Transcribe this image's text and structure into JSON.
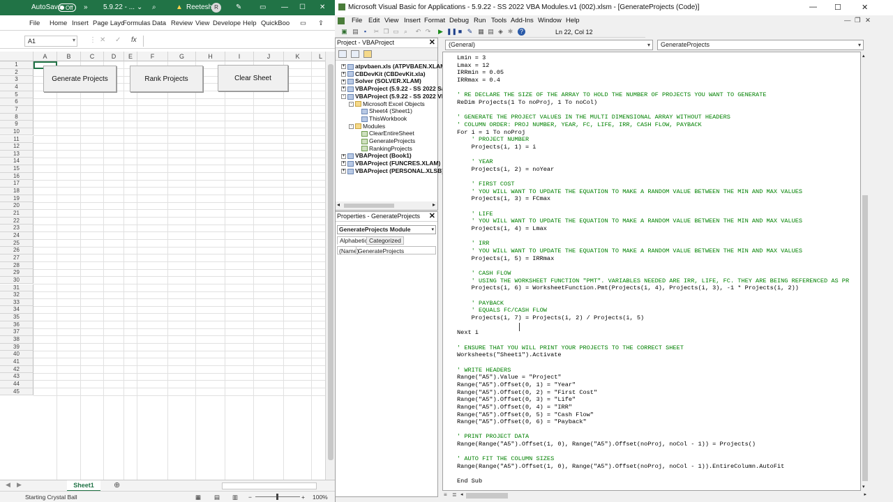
{
  "excel": {
    "autosave_label": "AutoSave",
    "autosave_state": "Off",
    "filename_short": "5.9.22 - ...",
    "user_name": "Reetesh",
    "user_initial": "R",
    "menu": [
      "File",
      "Home",
      "Insert",
      "Page Layo",
      "Formulas",
      "Data",
      "Review",
      "View",
      "Develope",
      "Help",
      "QuickBoo"
    ],
    "name_box": "A1",
    "fx": "fx",
    "columns": [
      "A",
      "B",
      "C",
      "D",
      "E",
      "F",
      "G",
      "H",
      "I",
      "J",
      "K",
      "L"
    ],
    "rows": [
      "1",
      "2",
      "3",
      "4",
      "5",
      "6",
      "7",
      "8",
      "9",
      "10",
      "11",
      "12",
      "13",
      "14",
      "15",
      "16",
      "17",
      "18",
      "19",
      "20",
      "21",
      "22",
      "23",
      "24",
      "25",
      "26",
      "27",
      "28",
      "29",
      "30",
      "31",
      "32",
      "33",
      "34",
      "35",
      "36",
      "37",
      "38",
      "39",
      "40",
      "41",
      "42",
      "43",
      "44",
      "45"
    ],
    "buttons": {
      "generate": "Generate Projects",
      "rank": "Rank Projects",
      "clear": "Clear Sheet"
    },
    "sheet_tab": "Sheet1",
    "status": "Starting Crystal Ball",
    "zoom": "100%"
  },
  "vba": {
    "title": "Microsoft Visual Basic for Applications - 5.9.22 - SS 2022 VBA Modules.v1 (002).xlsm - [GenerateProjects (Code)]",
    "menu": [
      "File",
      "Edit",
      "View",
      "Insert",
      "Format",
      "Debug",
      "Run",
      "Tools",
      "Add-Ins",
      "Window",
      "Help"
    ],
    "position": "Ln 22, Col 12",
    "project_title": "Project - VBAProject",
    "tree": [
      {
        "text": "atpvbaen.xls (ATPVBAEN.XLAM)",
        "level": 0,
        "bold": true,
        "toggle": "+",
        "icon": "proj"
      },
      {
        "text": "CBDevKit (CBDevKit.xla)",
        "level": 0,
        "bold": true,
        "toggle": "+",
        "icon": "proj"
      },
      {
        "text": "Solver (SOLVER.XLAM)",
        "level": 0,
        "bold": true,
        "toggle": "+",
        "icon": "proj"
      },
      {
        "text": "VBAProject (5.9.22 - SS 2022 Sa",
        "level": 0,
        "bold": true,
        "toggle": "+",
        "icon": "proj"
      },
      {
        "text": "VBAProject (5.9.22 - SS 2022 VI",
        "level": 0,
        "bold": true,
        "toggle": "-",
        "icon": "proj"
      },
      {
        "text": "Microsoft Excel Objects",
        "level": 1,
        "bold": false,
        "toggle": "-",
        "icon": "folder"
      },
      {
        "text": "Sheet4 (Sheet1)",
        "level": 2,
        "bold": false,
        "toggle": "",
        "icon": "sheet"
      },
      {
        "text": "ThisWorkbook",
        "level": 2,
        "bold": false,
        "toggle": "",
        "icon": "sheet"
      },
      {
        "text": "Modules",
        "level": 1,
        "bold": false,
        "toggle": "-",
        "icon": "folder"
      },
      {
        "text": "ClearEntireSheet",
        "level": 2,
        "bold": false,
        "toggle": "",
        "icon": "mod"
      },
      {
        "text": "GenerateProjects",
        "level": 2,
        "bold": false,
        "toggle": "",
        "icon": "mod"
      },
      {
        "text": "RankingProjects",
        "level": 2,
        "bold": false,
        "toggle": "",
        "icon": "mod"
      },
      {
        "text": "VBAProject (Book1)",
        "level": 0,
        "bold": true,
        "toggle": "+",
        "icon": "proj"
      },
      {
        "text": "VBAProject (FUNCRES.XLAM)",
        "level": 0,
        "bold": true,
        "toggle": "+",
        "icon": "proj"
      },
      {
        "text": "VBAProject (PERSONAL.XLSB)",
        "level": 0,
        "bold": true,
        "toggle": "+",
        "icon": "proj"
      }
    ],
    "properties_title": "Properties - GenerateProjects",
    "properties_object": "GenerateProjects Module",
    "properties_tabs": [
      "Alphabetic",
      "Categorized"
    ],
    "properties_name_key": "(Name)",
    "properties_name_value": "GenerateProjects",
    "combo_general": "(General)",
    "combo_proc": "GenerateProjects",
    "code_lines": [
      {
        "t": "Lmin = 3",
        "c": "#000"
      },
      {
        "t": "Lmax = 12",
        "c": "#000"
      },
      {
        "t": "IRRmin = 0.05",
        "c": "#000"
      },
      {
        "t": "IRRmax = 0.4",
        "c": "#000"
      },
      {
        "t": "",
        "c": "#000"
      },
      {
        "t": "' RE DECLARE THE SIZE OF THE ARRAY TO HOLD THE NUMBER OF PROJECTS YOU WANT TO GENERATE",
        "c": "#008000"
      },
      {
        "t": "ReDim Projects(1 To noProj, 1 To noCol)",
        "c": "#000"
      },
      {
        "t": "",
        "c": "#000"
      },
      {
        "t": "' GENERATE THE PROJECT VALUES IN THE MULTI DIMENSIONAL ARRAY WITHOUT HEADERS",
        "c": "#008000"
      },
      {
        "t": "' COLUMN ORDER: PROJ NUMBER, YEAR, FC, LIFE, IRR, CASH FLOW, PAYBACK",
        "c": "#008000"
      },
      {
        "t": "For i = 1 To noProj",
        "c": "#000"
      },
      {
        "t": "    ' PROJECT NUMBER",
        "c": "#008000"
      },
      {
        "t": "    Projects(i, 1) = i",
        "c": "#000"
      },
      {
        "t": "",
        "c": "#000"
      },
      {
        "t": "    ' YEAR",
        "c": "#008000"
      },
      {
        "t": "    Projects(i, 2) = noYear",
        "c": "#000"
      },
      {
        "t": "",
        "c": "#000"
      },
      {
        "t": "    ' FIRST COST",
        "c": "#008000"
      },
      {
        "t": "    ' YOU WILL WANT TO UPDATE THE EQUATION TO MAKE A RANDOM VALUE BETWEEN THE MIN AND MAX VALUES",
        "c": "#008000"
      },
      {
        "t": "    Projects(i, 3) = FCmax",
        "c": "#000"
      },
      {
        "t": "",
        "c": "#000"
      },
      {
        "t": "    ' LIFE",
        "c": "#008000"
      },
      {
        "t": "    ' YOU WILL WANT TO UPDATE THE EQUATION TO MAKE A RANDOM VALUE BETWEEN THE MIN AND MAX VALUES",
        "c": "#008000"
      },
      {
        "t": "    Projects(i, 4) = Lmax",
        "c": "#000"
      },
      {
        "t": "",
        "c": "#000"
      },
      {
        "t": "    ' IRR",
        "c": "#008000"
      },
      {
        "t": "    ' YOU WILL WANT TO UPDATE THE EQUATION TO MAKE A RANDOM VALUE BETWEEN THE MIN AND MAX VALUES",
        "c": "#008000"
      },
      {
        "t": "    Projects(i, 5) = IRRmax",
        "c": "#000"
      },
      {
        "t": "",
        "c": "#000"
      },
      {
        "t": "    ' CASH FLOW",
        "c": "#008000"
      },
      {
        "t": "    ' USING THE WORKSHEET FUNCTION \"PMT\". VARIABLES NEEDED ARE IRR, LIFE, FC. THEY ARE BEING REFERENCED AS PR",
        "c": "#008000"
      },
      {
        "t": "    Projects(i, 6) = WorksheetFunction.Pmt(Projects(i, 4), Projects(i, 3), -1 * Projects(i, 2))",
        "c": "#000"
      },
      {
        "t": "",
        "c": "#000"
      },
      {
        "t": "    ' PAYBACK",
        "c": "#008000"
      },
      {
        "t": "    ' EQUALS FC/CASH FLOW",
        "c": "#008000"
      },
      {
        "t": "    Projects(i, 7) = Projects(i, 2) / Projects(i, 5)",
        "c": "#000"
      },
      {
        "t": "",
        "c": "#000"
      },
      {
        "t": "Next i",
        "c": "#000"
      },
      {
        "t": "",
        "c": "#000"
      },
      {
        "t": "' ENSURE THAT YOU WILL PRINT YOUR PROJECTS TO THE CORRECT SHEET",
        "c": "#008000"
      },
      {
        "t": "Worksheets(\"Sheet1\").Activate",
        "c": "#000"
      },
      {
        "t": "",
        "c": "#000"
      },
      {
        "t": "' WRITE HEADERS",
        "c": "#008000"
      },
      {
        "t": "Range(\"A5\").Value = \"Project\"",
        "c": "#000"
      },
      {
        "t": "Range(\"A5\").Offset(0, 1) = \"Year\"",
        "c": "#000"
      },
      {
        "t": "Range(\"A5\").Offset(0, 2) = \"First Cost\"",
        "c": "#000"
      },
      {
        "t": "Range(\"A5\").Offset(0, 3) = \"Life\"",
        "c": "#000"
      },
      {
        "t": "Range(\"A5\").Offset(0, 4) = \"IRR\"",
        "c": "#000"
      },
      {
        "t": "Range(\"A5\").Offset(0, 5) = \"Cash Flow\"",
        "c": "#000"
      },
      {
        "t": "Range(\"A5\").Offset(0, 6) = \"Payback\"",
        "c": "#000"
      },
      {
        "t": "",
        "c": "#000"
      },
      {
        "t": "' PRINT PROJECT DATA",
        "c": "#008000"
      },
      {
        "t": "Range(Range(\"A5\").Offset(1, 0), Range(\"A5\").Offset(noProj, noCol - 1)) = Projects()",
        "c": "#000"
      },
      {
        "t": "",
        "c": "#000"
      },
      {
        "t": "' AUTO FIT THE COLUMN SIZES",
        "c": "#008000"
      },
      {
        "t": "Range(Range(\"A5\").Offset(1, 0), Range(\"A5\").Offset(noProj, noCol - 1)).EntireColumn.AutoFit",
        "c": "#000"
      },
      {
        "t": "",
        "c": "#000"
      },
      {
        "t": "End Sub",
        "c": "#000"
      }
    ]
  }
}
